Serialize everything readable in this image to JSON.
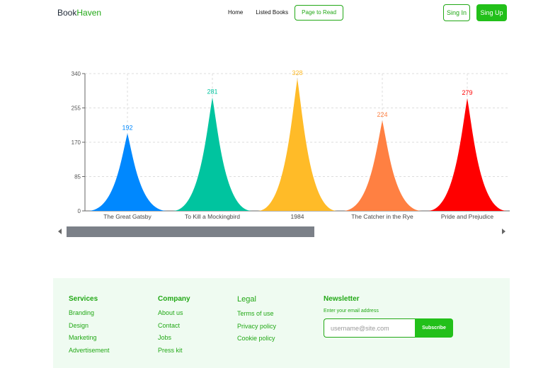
{
  "brand": {
    "part1": "Book",
    "part2": "Haven"
  },
  "nav": {
    "links": [
      "Home",
      "Listed Books",
      "Page to Read"
    ],
    "signin": "Sing In",
    "signup": "Sing Up"
  },
  "chart_data": {
    "type": "area",
    "categories": [
      "The Great Gatsby",
      "To Kill a Mockingbird",
      "1984",
      "The Catcher in the Rye",
      "Pride and Prejudice"
    ],
    "values": [
      192,
      281,
      328,
      224,
      279
    ],
    "colors": [
      "#0088FE",
      "#00C49F",
      "#FFBB28",
      "#FF8042",
      "#FF0000"
    ],
    "yticks": [
      0,
      85,
      170,
      255,
      340
    ],
    "ylim": [
      0,
      340
    ],
    "grid": true,
    "title": "",
    "xlabel": "",
    "ylabel": ""
  },
  "footer": {
    "services": {
      "title": "Services",
      "items": [
        "Branding",
        "Design",
        "Marketing",
        "Advertisement"
      ]
    },
    "company": {
      "title": "Company",
      "items": [
        "About us",
        "Contact",
        "Jobs",
        "Press kit"
      ]
    },
    "legal": {
      "title": "Legal",
      "items": [
        "Terms of use",
        "Privacy policy",
        "Cookie policy"
      ]
    },
    "newsletter": {
      "title": "Newsletter",
      "label": "Enter your email address",
      "placeholder": "username@site.com",
      "button": "Subscribe"
    }
  }
}
